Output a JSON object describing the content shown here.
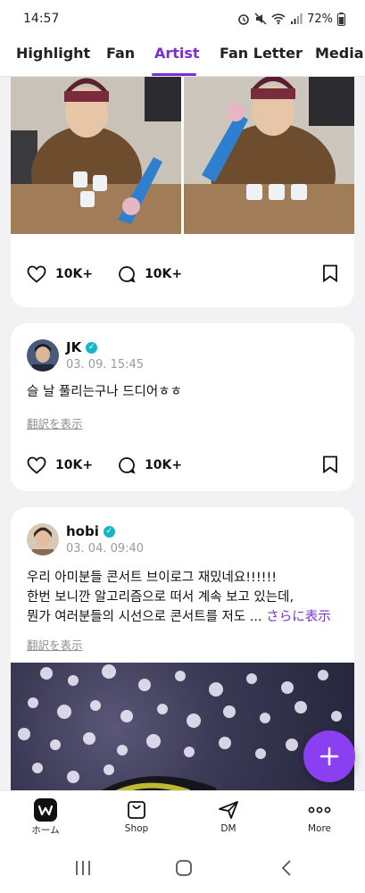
{
  "status_bar": {
    "time": "14:57",
    "battery": "72%"
  },
  "tabs": [
    {
      "label": "Highlight",
      "active": false
    },
    {
      "label": "Fan",
      "active": false
    },
    {
      "label": "Artist",
      "active": true
    },
    {
      "label": "Fan Letter",
      "active": false
    },
    {
      "label": "Media",
      "active": false
    }
  ],
  "posts": [
    {
      "likes": "10K+",
      "comments": "10K+"
    },
    {
      "author": "JK",
      "date": "03. 09. 15:45",
      "text": "슬 날 풀리는구나 드디어ㅎㅎ",
      "translate_label": "翻訳を表示",
      "likes": "10K+",
      "comments": "10K+"
    },
    {
      "author": "hobi",
      "date": "03. 04. 09:40",
      "text_line1": "우리 아미분들 콘서트 브이로그 재밌네요!!!!!!",
      "text_line2": "한번 보니깐 알고리즘으로 떠서 계속 보고 있는데,",
      "text_line3": "뭔가 여러분들의 시선으로 콘서트를 저도 ...",
      "more_label": "さらに表示",
      "translate_label": "翻訳を表示"
    }
  ],
  "bottom_nav": [
    {
      "label": "ホーム",
      "icon": "weverse-home-icon"
    },
    {
      "label": "Shop",
      "icon": "shopping-bag-icon"
    },
    {
      "label": "DM",
      "icon": "paper-plane-icon"
    },
    {
      "label": "More",
      "icon": "more-dots-icon"
    }
  ],
  "colors": {
    "accent": "#7b2fd6",
    "fab": "#8a3ff0",
    "verified": "#15b7c6"
  }
}
